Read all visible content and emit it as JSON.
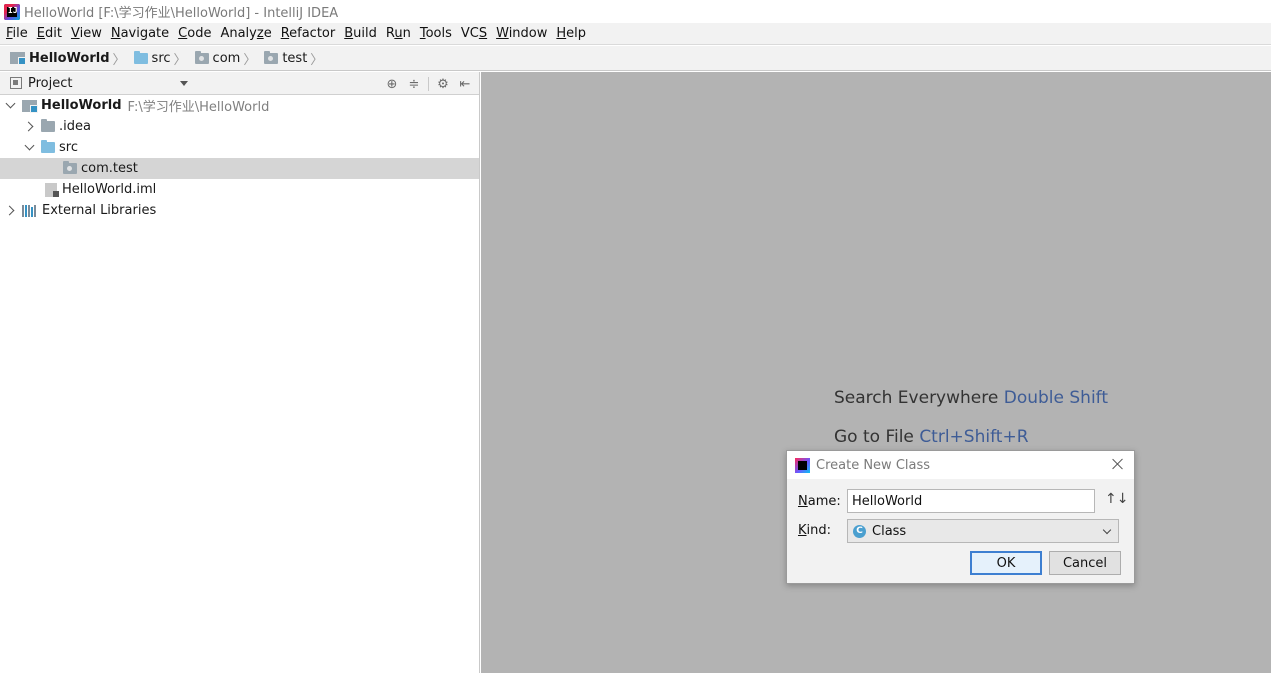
{
  "window": {
    "title": "HelloWorld [F:\\学习作业\\HelloWorld] - IntelliJ IDEA",
    "app_icon_text": "IJ"
  },
  "menu": [
    {
      "u": "F",
      "rest": "ile"
    },
    {
      "u": "E",
      "rest": "dit"
    },
    {
      "u": "V",
      "rest": "iew"
    },
    {
      "u": "N",
      "rest": "avigate"
    },
    {
      "u": "C",
      "rest": "ode"
    },
    {
      "u": "",
      "rest": "Analy",
      "u2": "z",
      "rest2": "e"
    },
    {
      "u": "R",
      "rest": "efactor"
    },
    {
      "u": "B",
      "rest": "uild"
    },
    {
      "u": "",
      "rest": "R",
      "u2": "u",
      "rest2": "n"
    },
    {
      "u": "T",
      "rest": "ools"
    },
    {
      "u": "",
      "rest": "VC",
      "u2": "S",
      "rest2": ""
    },
    {
      "u": "W",
      "rest": "indow"
    },
    {
      "u": "H",
      "rest": "elp"
    }
  ],
  "breadcrumb": [
    "HelloWorld",
    "src",
    "com",
    "test"
  ],
  "project_panel": {
    "header_label": "Project",
    "tree": [
      {
        "label": "HelloWorld",
        "path": "F:\\学习作业\\HelloWorld"
      },
      {
        "label": ".idea"
      },
      {
        "label": "src"
      },
      {
        "label": "com.test"
      },
      {
        "label": "HelloWorld.iml"
      },
      {
        "label": "External Libraries"
      }
    ]
  },
  "editor_hints": [
    {
      "text": "Search Everywhere",
      "key": "Double Shift"
    },
    {
      "text": "Go to File",
      "key": "Ctrl+Shift+R"
    }
  ],
  "dialog": {
    "title": "Create New Class",
    "name_label_u": "N",
    "name_label_rest": "ame:",
    "name_value": "HelloWorld",
    "kind_label_u": "K",
    "kind_label_rest": "ind:",
    "kind_icon": "C",
    "kind_value": "Class",
    "ok_label": "OK",
    "cancel_label": "Cancel",
    "sort_icon": "↑↓"
  },
  "colors": {
    "editor_bg": "#b3b3b3",
    "hint_key": "#3e5c96",
    "selection": "#d5d5d5",
    "ok_border": "#3d7fd1"
  }
}
